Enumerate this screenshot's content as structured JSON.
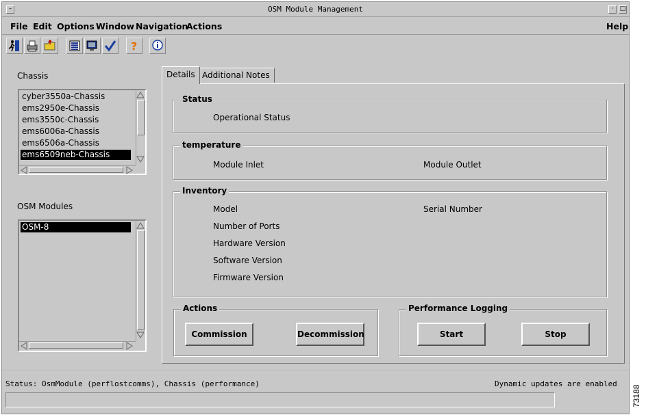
{
  "window": {
    "title": "OSM Module Management"
  },
  "menu": {
    "file": "File",
    "edit": "Edit",
    "options": "Options",
    "window": "Window",
    "navigation": "Navigation",
    "actions": "Actions",
    "help": "Help"
  },
  "toolbar": {
    "icons": [
      "exit-icon",
      "print-icon",
      "open-folder-icon",
      "list-icon",
      "monitor-icon",
      "checkmark-icon",
      "help-icon",
      "info-icon"
    ]
  },
  "chassis": {
    "label": "Chassis",
    "items": [
      "cyber3550a-Chassis",
      "ems2950e-Chassis",
      "ems3550c-Chassis",
      "ems6006a-Chassis",
      "ems6506a-Chassis",
      "ems6509neb-Chassis"
    ],
    "selected": "ems6509neb-Chassis"
  },
  "modules": {
    "label": "OSM Modules",
    "items": [
      "OSM-8"
    ],
    "selected": "OSM-8"
  },
  "tabs": {
    "details": "Details",
    "notes": "Additional Notes"
  },
  "status_group": {
    "title": "Status",
    "operational": "Operational Status"
  },
  "temperature": {
    "title": "temperature",
    "inlet": "Module Inlet",
    "outlet": "Module Outlet"
  },
  "inventory": {
    "title": "Inventory",
    "model": "Model",
    "serial": "Serial Number",
    "ports": "Number of Ports",
    "hardware": "Hardware Version",
    "software": "Software Version",
    "firmware": "Firmware Version"
  },
  "actions": {
    "title": "Actions",
    "commission": "Commission",
    "decommission": "Decommission"
  },
  "perf": {
    "title": "Performance Logging",
    "start": "Start",
    "stop": "Stop"
  },
  "statusbar": {
    "text": "Status: OsmModule (perflostcomms), Chassis (performance)",
    "dynamic": "Dynamic updates are enabled"
  },
  "figure_number": "73188",
  "colors": {
    "background": "#c8c8c8",
    "selection": "#000000"
  }
}
